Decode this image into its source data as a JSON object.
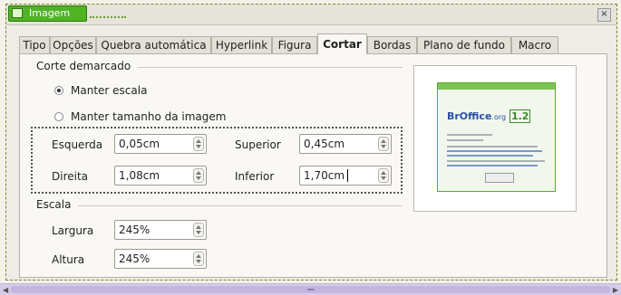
{
  "window": {
    "title": "Imagem",
    "close_glyph": "×"
  },
  "tabs": [
    {
      "label": "Tipo"
    },
    {
      "label": "Opções"
    },
    {
      "label": "Quebra automática"
    },
    {
      "label": "Hyperlink"
    },
    {
      "label": "Figura"
    },
    {
      "label": "Cortar",
      "active": true
    },
    {
      "label": "Bordas"
    },
    {
      "label": "Plano de fundo"
    },
    {
      "label": "Macro"
    }
  ],
  "crop": {
    "section_title": "Corte demarcado",
    "keep_scale": {
      "label": "Manter escala",
      "checked": true
    },
    "keep_size": {
      "label": "Manter tamanho da imagem",
      "checked": false
    },
    "left": {
      "label": "Esquerda",
      "value": "0,05cm"
    },
    "right": {
      "label": "Direita",
      "value": "1,08cm"
    },
    "top": {
      "label": "Superior",
      "value": "0,45cm"
    },
    "bottom": {
      "label": "Inferior",
      "value": "1,70cm"
    }
  },
  "scale": {
    "section_title": "Escala",
    "width": {
      "label": "Largura",
      "value": "245%"
    },
    "height": {
      "label": "Altura",
      "value": "245%"
    }
  },
  "preview": {
    "logo_text": "BrOffice",
    "logo_suffix": ".org",
    "logo_version": "1.2"
  },
  "colors": {
    "title_green": "#4fb323",
    "scrollbar": "#d6cbe8"
  },
  "icons": {
    "close": "close-icon",
    "app": "image-icon"
  }
}
